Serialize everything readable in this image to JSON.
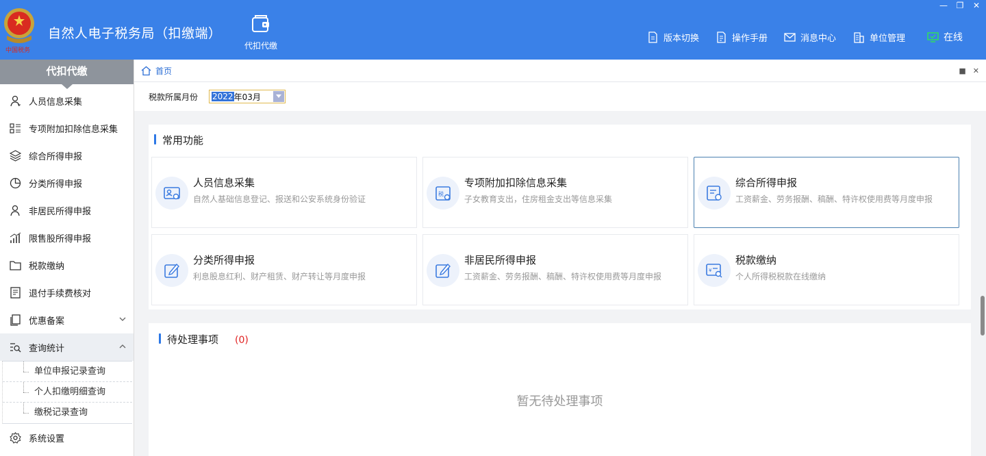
{
  "header": {
    "title": "自然人电子税务局（扣缴端）",
    "logo_icon": "tax-emblem-icon",
    "module": {
      "label": "代扣代缴",
      "icon": "wallet-icon"
    },
    "links": [
      {
        "label": "版本切换",
        "icon": "document-icon"
      },
      {
        "label": "操作手册",
        "icon": "manual-icon"
      },
      {
        "label": "消息中心",
        "icon": "mail-icon"
      },
      {
        "label": "单位管理",
        "icon": "building-icon"
      },
      {
        "label": "在线",
        "icon": "monitor-check-icon",
        "color": "#2fe05a"
      }
    ]
  },
  "sidebar": {
    "header": "代扣代缴",
    "items": [
      {
        "label": "人员信息采集",
        "icon": "person-icon"
      },
      {
        "label": "专项附加扣除信息采集",
        "icon": "list-icon"
      },
      {
        "label": "综合所得申报",
        "icon": "layers-icon"
      },
      {
        "label": "分类所得申报",
        "icon": "pie-icon"
      },
      {
        "label": "非居民所得申报",
        "icon": "person-outline-icon"
      },
      {
        "label": "限售股所得申报",
        "icon": "bar-chart-icon"
      },
      {
        "label": "税款缴纳",
        "icon": "folder-icon"
      },
      {
        "label": "退付手续费核对",
        "icon": "checklist-icon"
      },
      {
        "label": "优惠备案",
        "icon": "doc-copy-icon",
        "expandable": true,
        "expanded": false
      },
      {
        "label": "查询统计",
        "icon": "search-list-icon",
        "expandable": true,
        "expanded": true
      },
      {
        "label": "系统设置",
        "icon": "gear-icon"
      }
    ],
    "subitems": [
      {
        "label": "单位申报记录查询"
      },
      {
        "label": "个人扣缴明细查询"
      },
      {
        "label": "缴税记录查询"
      }
    ]
  },
  "breadcrumb": {
    "home": "首页"
  },
  "filter": {
    "label": "税款所属月份",
    "value_selected": "2022",
    "value_rest": "年03月"
  },
  "common": {
    "title": "常用功能",
    "cards": [
      {
        "title": "人员信息采集",
        "desc": "自然人基础信息登记、报送和公安系统身份验证",
        "icon": "id-card-icon"
      },
      {
        "title": "专项附加扣除信息采集",
        "desc": "子女教育支出，住房租金支出等信息采集",
        "icon": "tax-calendar-icon"
      },
      {
        "title": "综合所得申报",
        "desc": "工资薪金、劳务报酬、稿酬、特许权使用费等月度申报",
        "icon": "report-icon",
        "selected": true
      },
      {
        "title": "分类所得申报",
        "desc": "利息股息红利、财产租赁、财产转让等月度申报",
        "icon": "edit-icon"
      },
      {
        "title": "非居民所得申报",
        "desc": "工资薪金、劳务报酬、稿酬、特许权使用费等月度申报",
        "icon": "edit-icon"
      },
      {
        "title": "税款缴纳",
        "desc": "个人所得税税款在线缴纳",
        "icon": "payment-search-icon"
      }
    ]
  },
  "pending": {
    "title": "待处理事项",
    "count": "(0)",
    "empty": "暂无待处理事项"
  },
  "colors": {
    "header": "#3a81e8",
    "accent": "#2d78e6",
    "count": "#e02020"
  }
}
